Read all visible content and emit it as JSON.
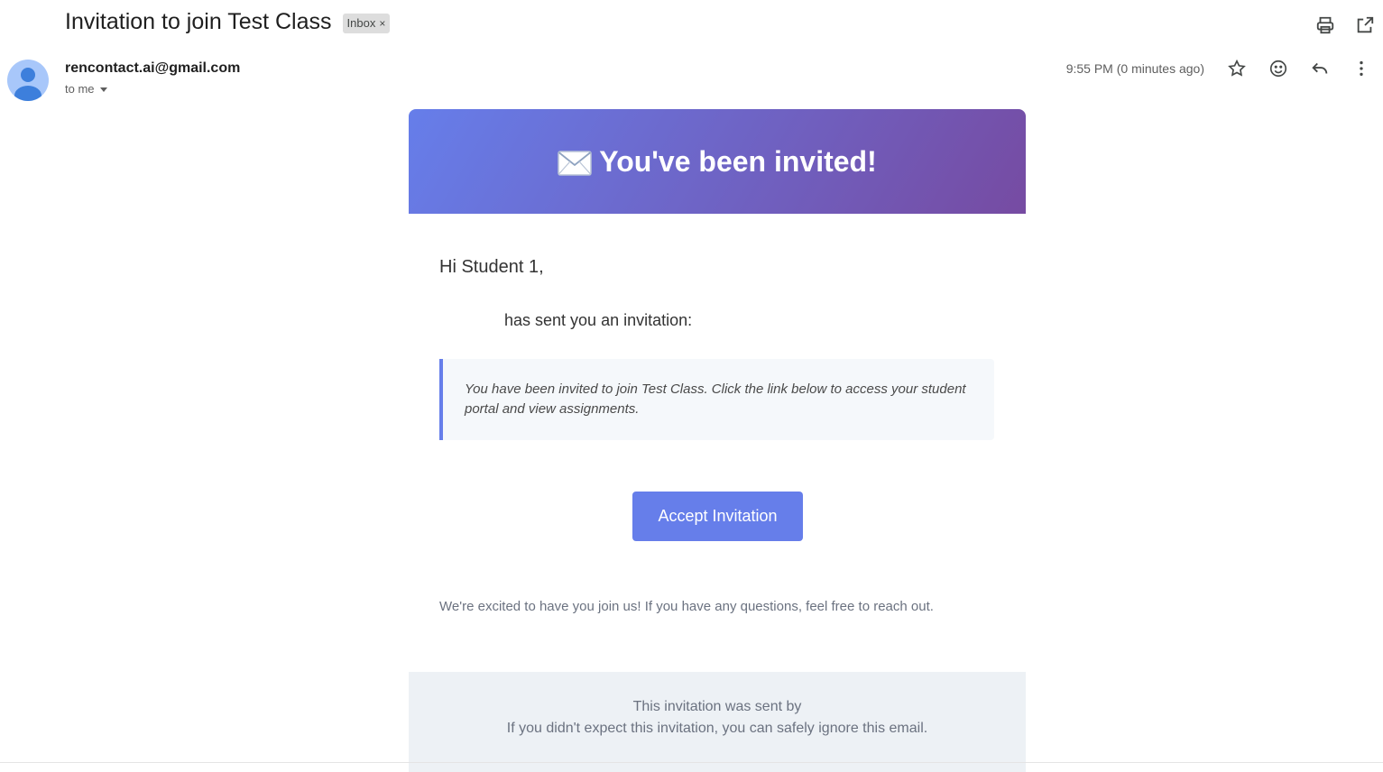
{
  "header": {
    "subject": "Invitation to join Test Class",
    "label": "Inbox",
    "label_remove": "×",
    "actions": [
      "print-icon",
      "open-in-new-window-icon"
    ]
  },
  "message": {
    "sender_email": "rencontact.ai@gmail.com",
    "recipient": "to me",
    "timestamp": "9:55 PM (0 minutes ago)",
    "actions": [
      "star-icon",
      "emoji-react-icon",
      "reply-icon",
      "more-vert-icon"
    ]
  },
  "email_body": {
    "banner_title": "You've been invited!",
    "banner_icon": "envelope-emoji",
    "greeting": "Hi Student 1,",
    "invite_line": "has sent you an invitation:",
    "message": "You have been invited to join Test Class. Click the link below to access your student portal and view assignments.",
    "button_label": "Accept Invitation",
    "closing": "We're excited to have you join us! If you have any questions, feel free to reach out.",
    "footer_line1": "This invitation was sent by",
    "footer_line2": "If you didn't expect this invitation, you can safely ignore this email."
  },
  "colors": {
    "banner_gradient_start": "#667eea",
    "banner_gradient_end": "#764ba2",
    "button": "#667eea",
    "footer_bg": "#edf1f5",
    "avatar": "#a8c7fa"
  }
}
